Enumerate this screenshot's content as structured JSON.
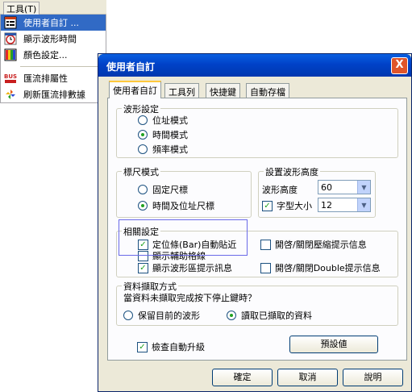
{
  "menubar": {
    "title": "工具(T)"
  },
  "menu": {
    "items": [
      {
        "label": "使用者自訂 ...",
        "icon": "customize-icon"
      },
      {
        "label": "顯示波形時間",
        "icon": "clock-icon"
      },
      {
        "label": "顏色設定...",
        "icon": "palette-icon"
      },
      {
        "label": "匯流排屬性",
        "icon": "bus-icon"
      },
      {
        "label": "刷新匯流排數據",
        "icon": "refresh-icon"
      }
    ]
  },
  "dialog": {
    "title": "使用者自訂",
    "close": "X",
    "tabs": [
      "使用者自訂",
      "工具列",
      "快捷鍵",
      "自動存檔"
    ],
    "waveform": {
      "title": "波形設定",
      "options": [
        "位址模式",
        "時間模式",
        "頻率模式"
      ],
      "selected": "時間模式"
    },
    "ruler": {
      "title": "標尺模式",
      "options": [
        "固定尺標",
        "時間及位址尺標"
      ],
      "selected": "時間及位址尺標"
    },
    "height": {
      "title": "設置波形高度",
      "height_label": "波形高度",
      "height_value": "60",
      "font_label": "字型大小",
      "font_value": "12"
    },
    "related": {
      "title": "相關設定",
      "bar_snap": "定位條(Bar)自動貼近",
      "compress_hint": "開啓/關閉壓縮提示信息",
      "grid": "顯示輔助格線",
      "waveform_hint": "顯示波形區提示訊息",
      "double_hint": "開啓/關閉Double提示信息"
    },
    "capture": {
      "title": "資料擷取方式",
      "question": "當資料未擷取完成按下停止鍵時？",
      "keep": "保留目前的波形",
      "read": "讀取已擷取的資料"
    },
    "auto_upgrade": "檢查自動升級",
    "defaults_button": "預設値",
    "ok_button": "確定",
    "cancel_button": "取消",
    "help_button": "說明"
  }
}
